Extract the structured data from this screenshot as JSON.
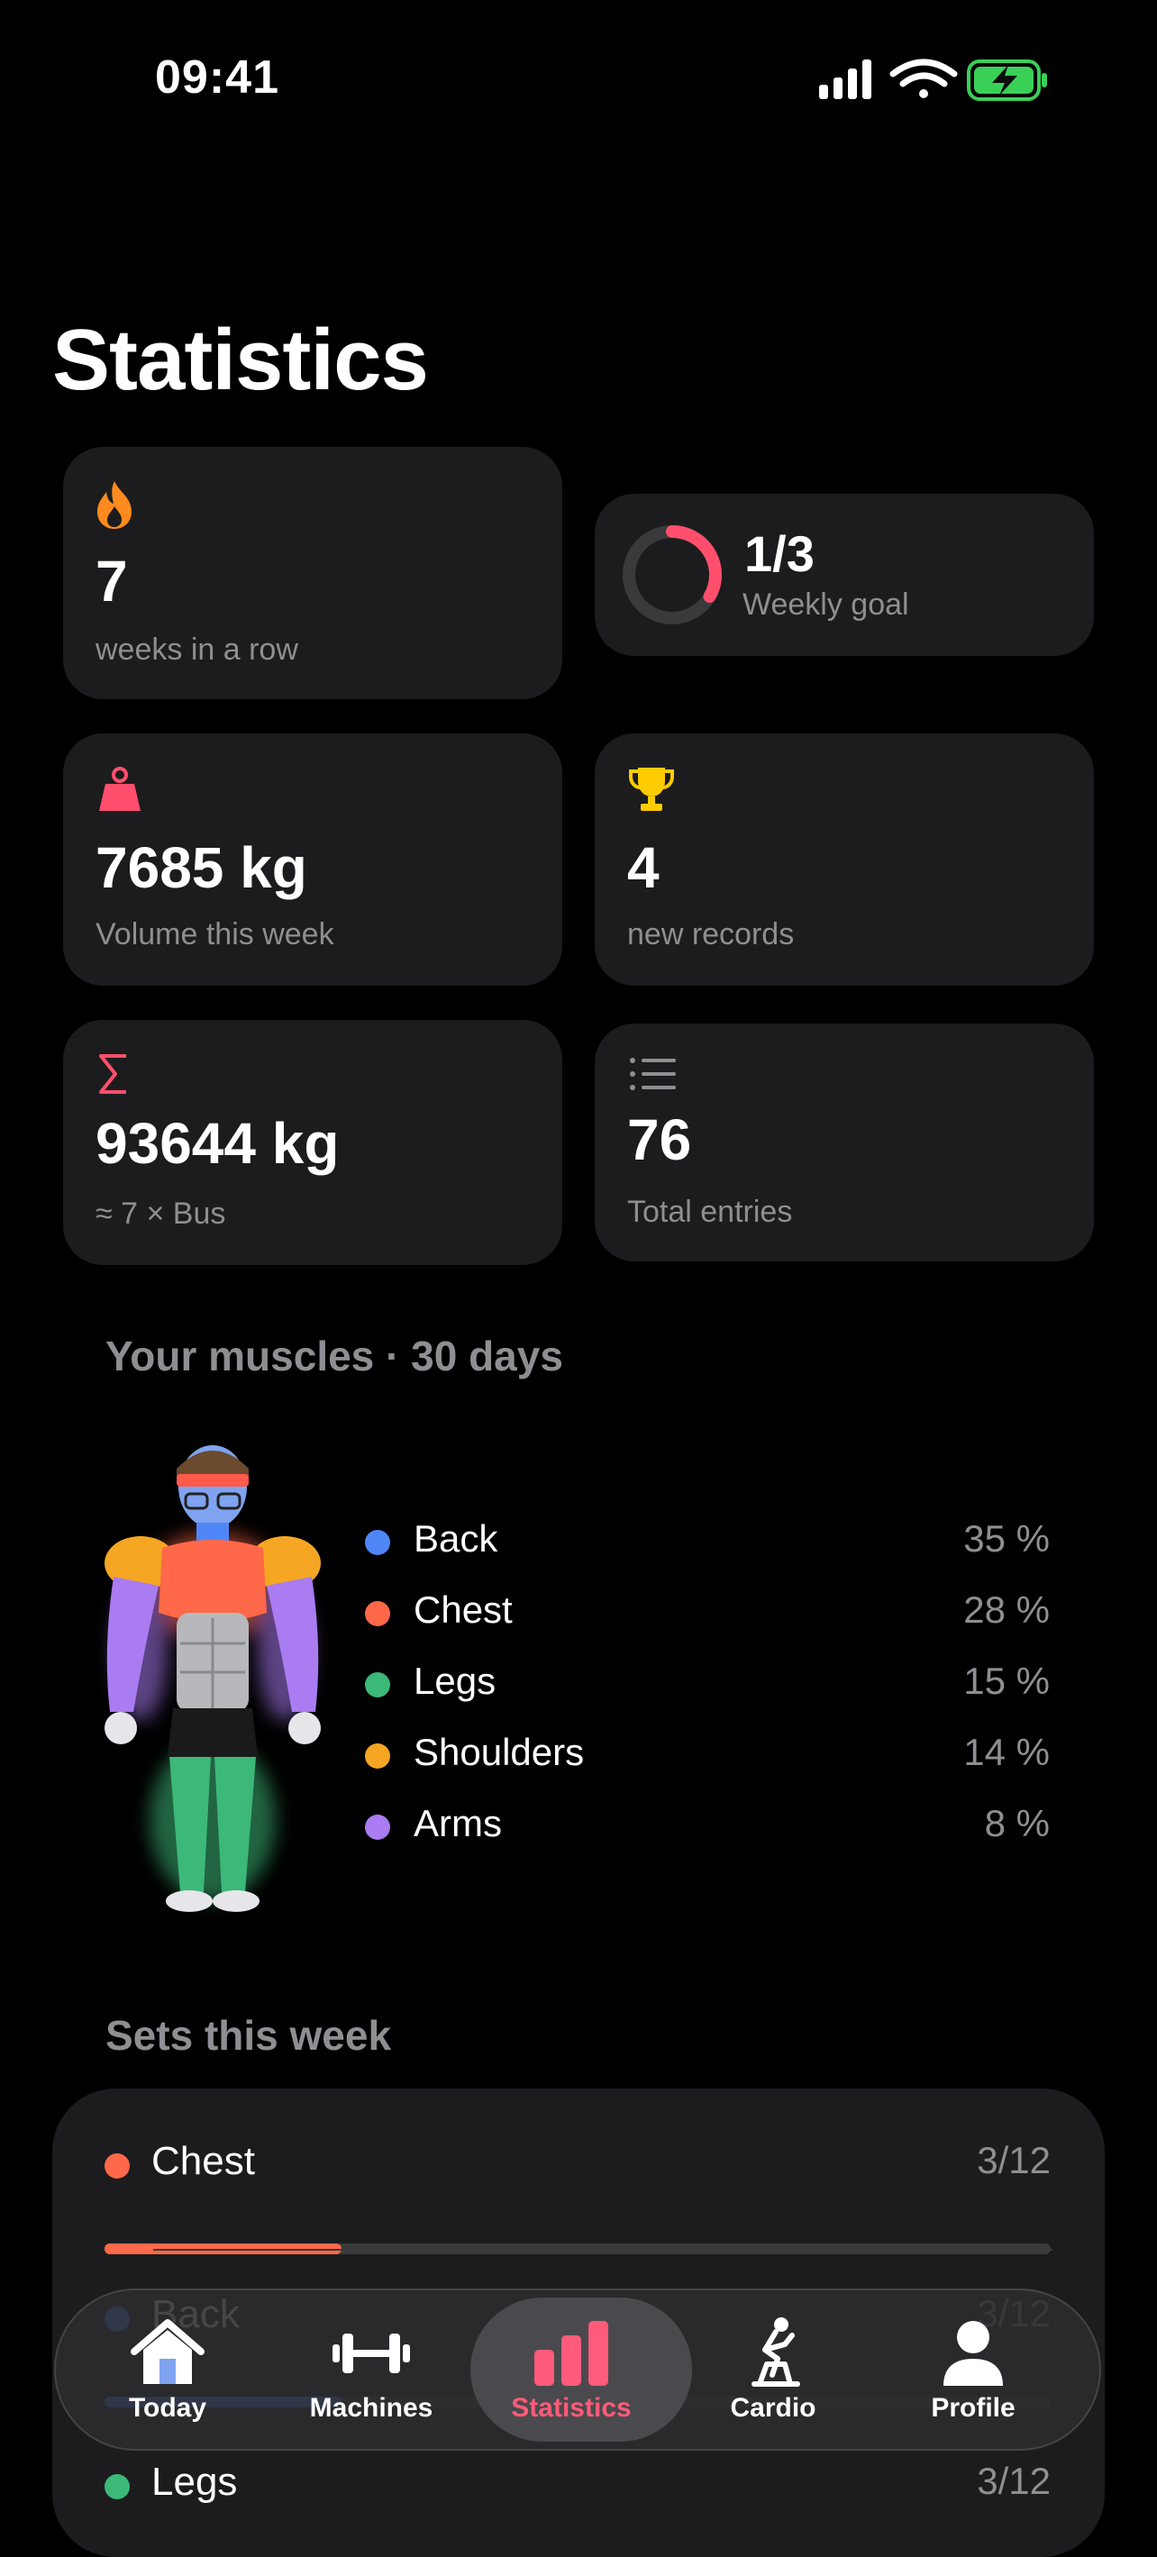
{
  "status_bar": {
    "time": "09:41"
  },
  "page": {
    "title": "Statistics"
  },
  "cards": {
    "streak": {
      "value": "7",
      "label": "weeks in a row"
    },
    "weekly_goal": {
      "value": "1/3",
      "label": "Weekly goal",
      "progress": 0.333
    },
    "volume": {
      "value": "7685 kg",
      "label": "Volume this week"
    },
    "records": {
      "value": "4",
      "label": "new records"
    },
    "total_volume": {
      "value": "93644 kg",
      "label": "≈ 7 × Bus"
    },
    "entries": {
      "value": "76",
      "label": "Total entries"
    }
  },
  "muscles": {
    "title": "Your muscles · 30 days",
    "items": [
      {
        "name": "Back",
        "pct": "35 %",
        "color": "#4f86f7"
      },
      {
        "name": "Chest",
        "pct": "28 %",
        "color": "#ff6848"
      },
      {
        "name": "Legs",
        "pct": "15 %",
        "color": "#3cb878"
      },
      {
        "name": "Shoulders",
        "pct": "14 %",
        "color": "#f5a623"
      },
      {
        "name": "Arms",
        "pct": "8 %",
        "color": "#a97cf2"
      }
    ]
  },
  "sets": {
    "title": "Sets this week",
    "items": [
      {
        "name": "Chest",
        "count": "3/12",
        "progress": 0.25,
        "color": "#ff6848"
      },
      {
        "name": "Back",
        "count": "3/12",
        "progress": 0.25,
        "color": "#4f86f7"
      },
      {
        "name": "Legs",
        "count": "3/12",
        "progress": 0.25,
        "color": "#3cb878"
      }
    ]
  },
  "tabbar": {
    "tabs": [
      {
        "label": "Today",
        "icon": "house-icon"
      },
      {
        "label": "Machines",
        "icon": "dumbbell-icon"
      },
      {
        "label": "Statistics",
        "icon": "bar-chart-icon",
        "active": true
      },
      {
        "label": "Cardio",
        "icon": "exercise-bike-icon"
      },
      {
        "label": "Profile",
        "icon": "person-icon"
      }
    ]
  },
  "colors": {
    "accent": "#ff5b7a",
    "card_bg": "#1c1c1e",
    "secondary_text": "#8e8e93"
  }
}
